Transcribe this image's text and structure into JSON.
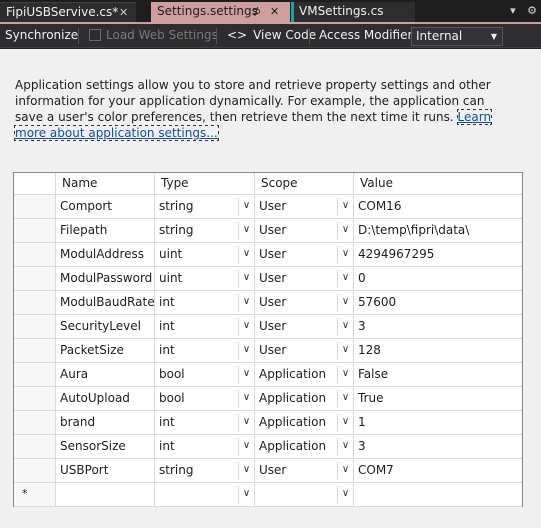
{
  "tabs": [
    {
      "label": "FipiUSBServive.cs*",
      "close": "✕"
    },
    {
      "label": "Settings.settings",
      "pin": "⊅",
      "close": "✕"
    },
    {
      "label": "VMSettings.cs"
    }
  ],
  "tab_tools": {
    "dropdown": "▾",
    "settings": "⚙"
  },
  "toolbar": {
    "synchronize": "Synchronize",
    "load_web_settings": "Load Web Settings",
    "view_code": "View Code",
    "view_code_icon": "<>",
    "access_modifier_label": "Access Modifier:",
    "access_modifier_value": "Internal",
    "combo_arrow": "▼"
  },
  "description": {
    "text": "Application settings allow you to store and retrieve property settings and other information for your application dynamically. For example, the application can save a user's color preferences, then retrieve them the next time it runs.",
    "link": "Learn more about application settings..."
  },
  "grid": {
    "headers": {
      "name": "Name",
      "type": "Type",
      "scope": "Scope",
      "value": "Value"
    },
    "dropdown_glyph": "∨",
    "new_row_marker": "*",
    "rows": [
      {
        "name": "Comport",
        "type": "string",
        "scope": "User",
        "value": "COM16"
      },
      {
        "name": "Filepath",
        "type": "string",
        "scope": "User",
        "value": "D:\\temp\\fipri\\data\\"
      },
      {
        "name": "ModulAddress",
        "type": "uint",
        "scope": "User",
        "value": "4294967295"
      },
      {
        "name": "ModulPassword",
        "type": "uint",
        "scope": "User",
        "value": "0"
      },
      {
        "name": "ModulBaudRate",
        "type": "int",
        "scope": "User",
        "value": "57600"
      },
      {
        "name": "SecurityLevel",
        "type": "int",
        "scope": "User",
        "value": "3"
      },
      {
        "name": "PacketSize",
        "type": "int",
        "scope": "User",
        "value": "128"
      },
      {
        "name": "Aura",
        "type": "bool",
        "scope": "Application",
        "value": "False"
      },
      {
        "name": "AutoUpload",
        "type": "bool",
        "scope": "Application",
        "value": "True"
      },
      {
        "name": "brand",
        "type": "int",
        "scope": "Application",
        "value": "1"
      },
      {
        "name": "SensorSize",
        "type": "int",
        "scope": "Application",
        "value": "3"
      },
      {
        "name": "USBPort",
        "type": "string",
        "scope": "User",
        "value": "COM7"
      }
    ]
  }
}
